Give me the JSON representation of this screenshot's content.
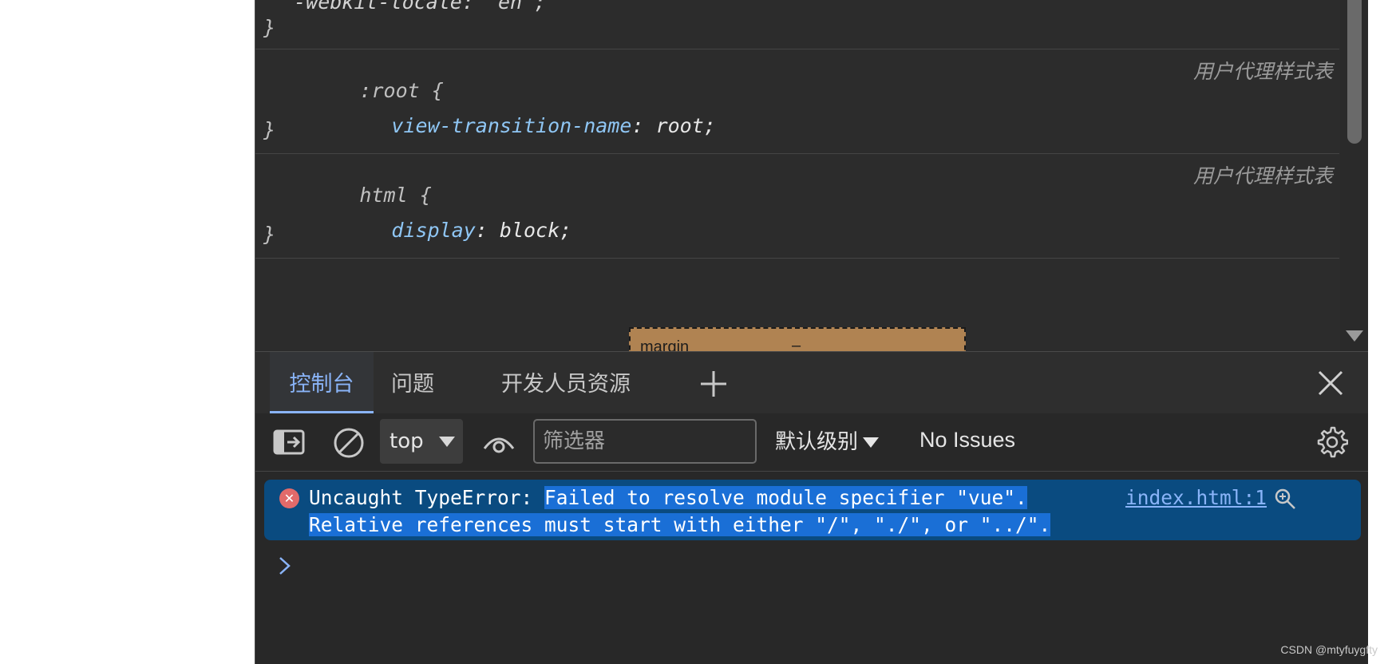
{
  "styles": {
    "partial_line": "  -webkit-locale: \"en\";",
    "rules": [
      {
        "selector": ":root",
        "property": "view-transition-name",
        "value": "root",
        "origin": "用户代理样式表"
      },
      {
        "selector": "html",
        "property": "display",
        "value": "block",
        "origin": "用户代理样式表"
      }
    ],
    "box_model_label": "margin",
    "box_model_value": "–"
  },
  "drawer": {
    "tabs": [
      {
        "label": "控制台",
        "active": true
      },
      {
        "label": "问题",
        "active": false
      },
      {
        "label": "开发人员资源",
        "active": false
      }
    ]
  },
  "toolbar": {
    "context": "top",
    "filter_placeholder": "筛选器",
    "level": "默认级别",
    "issues": "No Issues"
  },
  "console": {
    "error": {
      "prefix": "Uncaught TypeError: ",
      "message_line1": "Failed to resolve module specifier \"vue\".",
      "message_line2": "Relative references must start with either \"/\", \"./\", or \"../\".",
      "source": "index.html:1"
    }
  },
  "watermark": "CSDN @mtyfuygfty",
  "colors": {
    "accent": "#8ab4f8",
    "error_bg": "#0a4b80",
    "selection": "#1a6fd6",
    "error_icon": "#e26a6a"
  }
}
